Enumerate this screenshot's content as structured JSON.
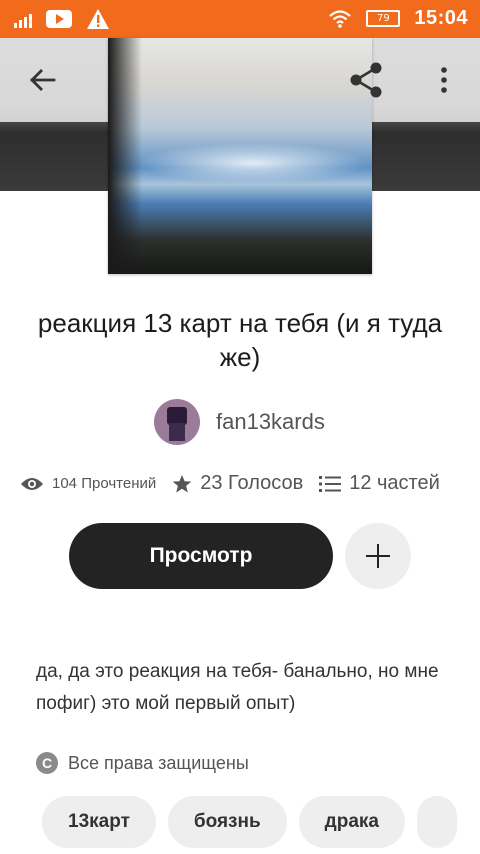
{
  "status_bar": {
    "battery": "79",
    "time": "15:04",
    "icons": [
      "signal-icon",
      "youtube-icon",
      "warning-icon",
      "wifi-icon",
      "battery-icon"
    ]
  },
  "toolbar": {
    "icons": [
      "back-arrow-icon",
      "share-icon",
      "more-vert-icon"
    ]
  },
  "story": {
    "title": "реакция 13 карт на тебя (и я туда же)",
    "author": "fan13kards",
    "reads": "104 Прочтений",
    "votes": "23 Голосов",
    "parts": "12 частей",
    "read_button": "Просмотр",
    "description": "да, да это реакция на тебя- банально, но мне пофиг) это мой первый опыт)",
    "copyright": "Все права защищены",
    "copyright_icon": "C",
    "tags": [
      "13карт",
      "боязнь",
      "драка"
    ]
  },
  "colors": {
    "accent": "#f26a1b",
    "button": "#232323"
  }
}
